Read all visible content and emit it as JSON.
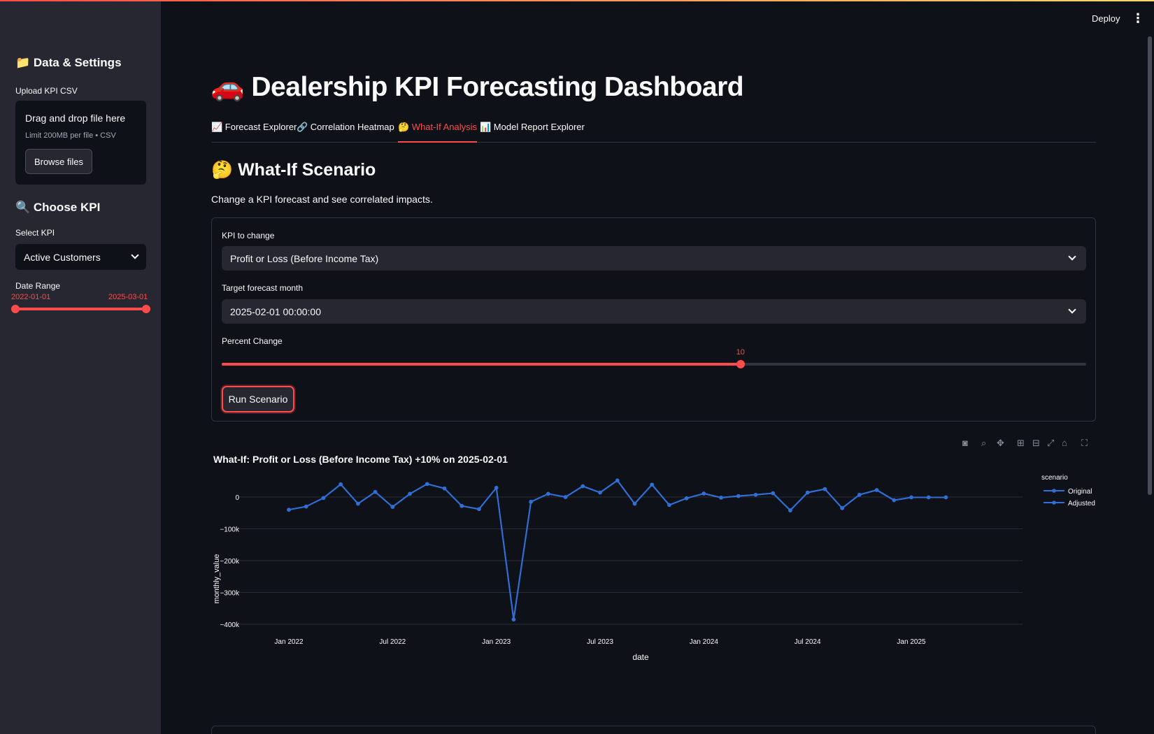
{
  "sidebar": {
    "data_heading": "📁 Data & Settings",
    "upload_label": "Upload KPI CSV",
    "dropzone_title": "Drag and drop file here",
    "dropzone_limit": "Limit 200MB per file • CSV",
    "browse_button": "Browse files",
    "kpi_heading": "🔍 Choose KPI",
    "select_kpi_label": "Select KPI",
    "select_kpi_value": "Active Customers",
    "date_range_label": "Date Range",
    "date_start": "2022-01-01",
    "date_end": "2025-03-01"
  },
  "header": {
    "deploy_label": "Deploy",
    "menu_icon": "⋮"
  },
  "main": {
    "title": "🚗 Dealership KPI Forecasting Dashboard",
    "tabs": [
      {
        "label": "📈 Forecast Explorer"
      },
      {
        "label": "🔗 Correlation Heatmap"
      },
      {
        "label": "🤔 What-If Analysis"
      },
      {
        "label": "📊 Model Report Explorer"
      }
    ],
    "active_tab": 2,
    "section_title": "🤔 What-If Scenario",
    "section_desc": "Change a KPI forecast and see correlated impacts.",
    "form": {
      "kpi_label": "KPI to change",
      "kpi_value": "Profit or Loss (Before Income Tax)",
      "month_label": "Target forecast month",
      "month_value": "2025-02-01 00:00:00",
      "percent_label": "Percent Change",
      "percent_value": "10",
      "percent_min": -50,
      "percent_max": 50,
      "run_button": "Run Scenario"
    }
  },
  "chart_data": {
    "type": "line",
    "title": "What-If: Profit or Loss (Before Income Tax) +10% on 2025-02-01",
    "xlabel": "date",
    "ylabel": "monthly_value",
    "legend_title": "scenario",
    "legend_position": "right",
    "ylim": [
      -400000,
      50000
    ],
    "y_ticks": [
      0,
      -100000,
      -200000,
      -300000,
      -400000
    ],
    "y_tick_labels": [
      "0",
      "−100k",
      "−200k",
      "−300k",
      "−400k"
    ],
    "x_tick_labels": [
      "Jan 2022",
      "Jul 2022",
      "Jan 2023",
      "Jul 2023",
      "Jan 2024",
      "Jul 2024",
      "Jan 2025"
    ],
    "x": [
      "2022-01",
      "2022-02",
      "2022-03",
      "2022-04",
      "2022-05",
      "2022-06",
      "2022-07",
      "2022-08",
      "2022-09",
      "2022-10",
      "2022-11",
      "2022-12",
      "2023-01",
      "2023-02",
      "2023-03",
      "2023-04",
      "2023-05",
      "2023-06",
      "2023-07",
      "2023-08",
      "2023-09",
      "2023-10",
      "2023-11",
      "2023-12",
      "2024-01",
      "2024-02",
      "2024-03",
      "2024-04",
      "2024-05",
      "2024-06",
      "2024-07",
      "2024-08",
      "2024-09",
      "2024-10",
      "2024-11",
      "2024-12",
      "2025-01",
      "2025-02",
      "2025-03"
    ],
    "series": [
      {
        "name": "Original",
        "color": "#2f6fd6",
        "values": [
          -40000,
          -30000,
          -3000,
          40000,
          -21000,
          16000,
          -31000,
          10000,
          41000,
          27000,
          -28000,
          -38000,
          29000,
          -385000,
          -15000,
          10000,
          0,
          34000,
          14000,
          52000,
          -21000,
          39000,
          -25000,
          -4000,
          11000,
          -2000,
          3000,
          7000,
          12000,
          -42000,
          14000,
          25000,
          -35000,
          7000,
          22000,
          -10000,
          -1000,
          -1000,
          -1000
        ]
      },
      {
        "name": "Adjusted",
        "color": "#2f6fd6",
        "values": [
          -40000,
          -30000,
          -3000,
          40000,
          -21000,
          16000,
          -31000,
          10000,
          41000,
          27000,
          -28000,
          -38000,
          29000,
          -385000,
          -15000,
          10000,
          0,
          34000,
          14000,
          52000,
          -21000,
          39000,
          -25000,
          -4000,
          11000,
          -2000,
          3000,
          7000,
          12000,
          -42000,
          14000,
          25000,
          -35000,
          7000,
          22000,
          -10000,
          -1000,
          -1000,
          -1000
        ]
      }
    ],
    "grid": true
  },
  "colors": {
    "accent": "#ff4b4b",
    "background": "#0e1117",
    "sidebar": "#262730",
    "line": "#2f6fd6"
  }
}
